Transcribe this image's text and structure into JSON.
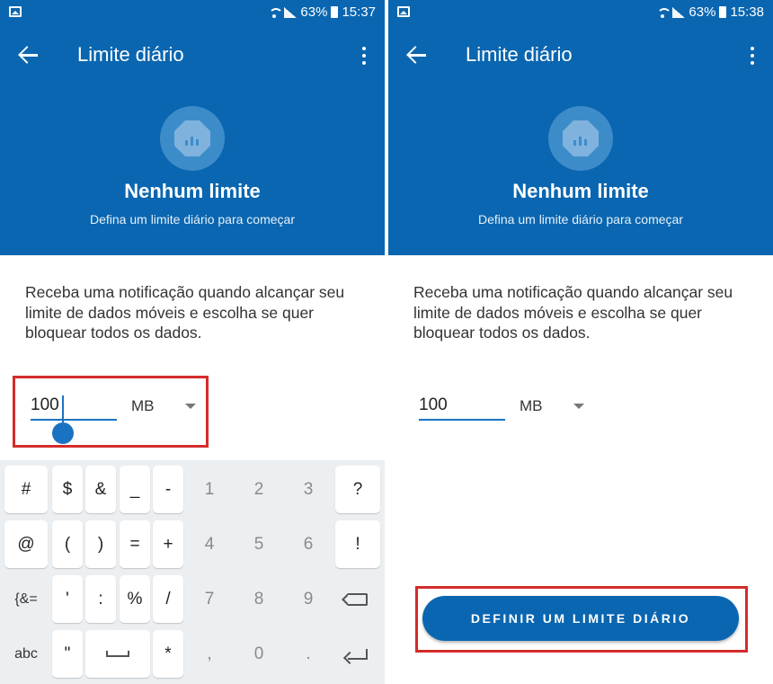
{
  "screens": [
    {
      "status": {
        "battery": "63%",
        "time": "15:37"
      },
      "appbar": {
        "title": "Limite diário"
      },
      "hero": {
        "title": "Nenhum limite",
        "subtitle": "Defina um limite diário para começar"
      },
      "description": "Receba uma notificação quando alcançar seu limite de dados móveis e escolha se quer bloquear todos os dados.",
      "limit_value": "100",
      "unit": "MB"
    },
    {
      "status": {
        "battery": "63%",
        "time": "15:38"
      },
      "appbar": {
        "title": "Limite diário"
      },
      "hero": {
        "title": "Nenhum limite",
        "subtitle": "Defina um limite diário para começar"
      },
      "description": "Receba uma notificação quando alcançar seu limite de dados móveis e escolha se quer bloquear todos os dados.",
      "limit_value": "100",
      "unit": "MB",
      "primary_button": "DEFINIR UM LIMITE DIÁRIO"
    }
  ],
  "keyboard": {
    "rows": [
      [
        "#",
        "$",
        "&",
        "_",
        "-",
        "1",
        "2",
        "3",
        "?"
      ],
      [
        "@",
        "(",
        ")",
        "=",
        "+",
        "4",
        "5",
        "6",
        "!"
      ],
      [
        "{&=",
        "'",
        ":",
        "%",
        "/",
        "7",
        "8",
        "9",
        "backspace-icon"
      ],
      [
        "abc",
        "\"",
        "space-icon",
        "*",
        ",",
        "0",
        ".",
        "enter-icon"
      ]
    ]
  },
  "colors": {
    "primary": "#0a66b0",
    "highlight": "#d42b2b",
    "accent": "#1a73c2"
  }
}
